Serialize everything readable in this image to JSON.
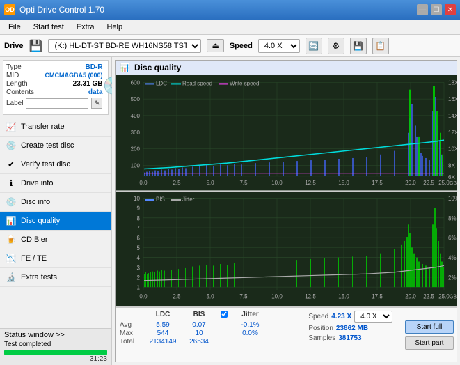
{
  "app": {
    "title": "Opti Drive Control 1.70",
    "icon": "OD"
  },
  "titlebar": {
    "minimize": "—",
    "maximize": "☐",
    "close": "✕"
  },
  "menubar": {
    "items": [
      "File",
      "Start test",
      "Extra",
      "Help"
    ]
  },
  "drivebar": {
    "drive_label": "Drive",
    "drive_value": "(K:) HL-DT-ST BD-RE WH16NS58 TST4",
    "speed_label": "Speed",
    "speed_value": "4.0 X"
  },
  "disc_info": {
    "type_label": "Type",
    "type_value": "BD-R",
    "mid_label": "MID",
    "mid_value": "CMCMAGBA5 (000)",
    "length_label": "Length",
    "length_value": "23.31 GB",
    "contents_label": "Contents",
    "contents_value": "data",
    "label_label": "Label"
  },
  "nav": {
    "items": [
      {
        "id": "transfer-rate",
        "label": "Transfer rate",
        "icon": "📈"
      },
      {
        "id": "create-test-disc",
        "label": "Create test disc",
        "icon": "💿"
      },
      {
        "id": "verify-test-disc",
        "label": "Verify test disc",
        "icon": "✔"
      },
      {
        "id": "drive-info",
        "label": "Drive info",
        "icon": "ℹ"
      },
      {
        "id": "disc-info",
        "label": "Disc info",
        "icon": "💿"
      },
      {
        "id": "disc-quality",
        "label": "Disc quality",
        "icon": "📊",
        "active": true
      },
      {
        "id": "cd-bier",
        "label": "CD Bier",
        "icon": "🍺"
      },
      {
        "id": "fe-te",
        "label": "FE / TE",
        "icon": "📉"
      },
      {
        "id": "extra-tests",
        "label": "Extra tests",
        "icon": "🔬"
      }
    ]
  },
  "status_bar": {
    "label": "Status window >>",
    "completed_label": "Test completed",
    "progress_percent": 100,
    "time": "31:23"
  },
  "disc_quality": {
    "title": "Disc quality",
    "chart1": {
      "legend": {
        "ldc": "LDC",
        "read": "Read speed",
        "write": "Write speed"
      },
      "y_left_max": 600,
      "y_right_max": 18,
      "y_right_unit": "X",
      "x_max": 25,
      "x_label": "GB"
    },
    "chart2": {
      "legend": {
        "bis": "BIS",
        "jitter": "Jitter"
      },
      "y_left_max": 10,
      "y_right_max": 10,
      "y_right_unit": "%",
      "x_max": 25,
      "x_label": "GB"
    },
    "stats": {
      "headers": [
        "LDC",
        "BIS",
        "",
        "Jitter"
      ],
      "avg_label": "Avg",
      "avg_ldc": "5.59",
      "avg_bis": "0.07",
      "avg_jitter": "-0.1%",
      "max_label": "Max",
      "max_ldc": "544",
      "max_bis": "10",
      "max_jitter": "0.0%",
      "total_label": "Total",
      "total_ldc": "2134149",
      "total_bis": "26534",
      "jitter_checked": true,
      "speed_label": "Speed",
      "speed_value": "4.23 X",
      "speed_dropdown": "4.0 X",
      "position_label": "Position",
      "position_value": "23862 MB",
      "samples_label": "Samples",
      "samples_value": "381753",
      "start_full_label": "Start full",
      "start_part_label": "Start part"
    }
  }
}
